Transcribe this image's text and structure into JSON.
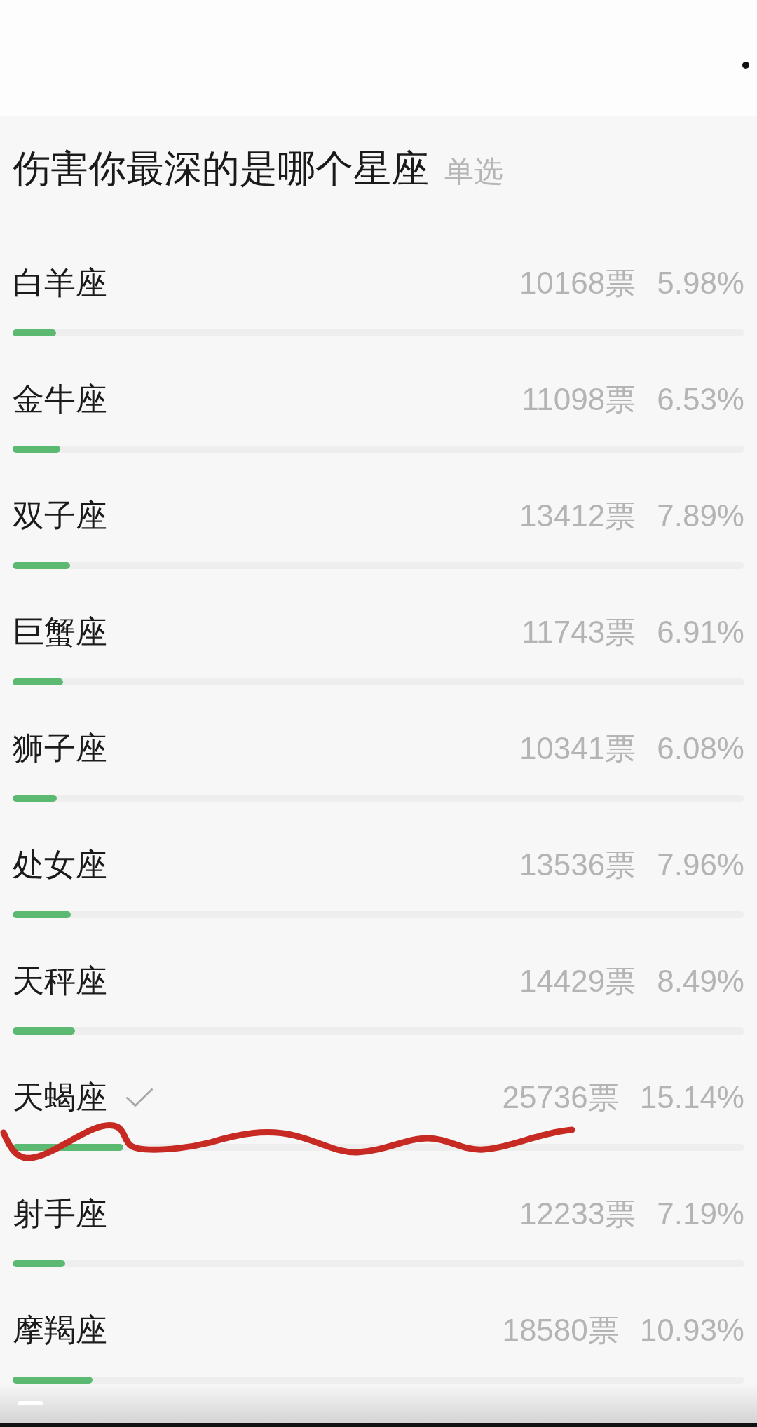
{
  "poll": {
    "title": "伤害你最深的是哪个星座",
    "tag": "单选"
  },
  "options": [
    {
      "label": "白羊座",
      "votes": "10168票",
      "percent": "5.98%",
      "level": 0.0598,
      "selected": false
    },
    {
      "label": "金牛座",
      "votes": "11098票",
      "percent": "6.53%",
      "level": 0.0653,
      "selected": false
    },
    {
      "label": "双子座",
      "votes": "13412票",
      "percent": "7.89%",
      "level": 0.0789,
      "selected": false
    },
    {
      "label": "巨蟹座",
      "votes": "11743票",
      "percent": "6.91%",
      "level": 0.0691,
      "selected": false
    },
    {
      "label": "狮子座",
      "votes": "10341票",
      "percent": "6.08%",
      "level": 0.0608,
      "selected": false
    },
    {
      "label": "处女座",
      "votes": "13536票",
      "percent": "7.96%",
      "level": 0.0796,
      "selected": false
    },
    {
      "label": "天秤座",
      "votes": "14429票",
      "percent": "8.49%",
      "level": 0.0849,
      "selected": false
    },
    {
      "label": "天蝎座",
      "votes": "25736票",
      "percent": "15.14%",
      "level": 0.1514,
      "selected": true
    },
    {
      "label": "射手座",
      "votes": "12233票",
      "percent": "7.19%",
      "level": 0.0719,
      "selected": false
    },
    {
      "label": "摩羯座",
      "votes": "18580票",
      "percent": "10.93%",
      "level": 0.1093,
      "selected": false
    }
  ]
}
